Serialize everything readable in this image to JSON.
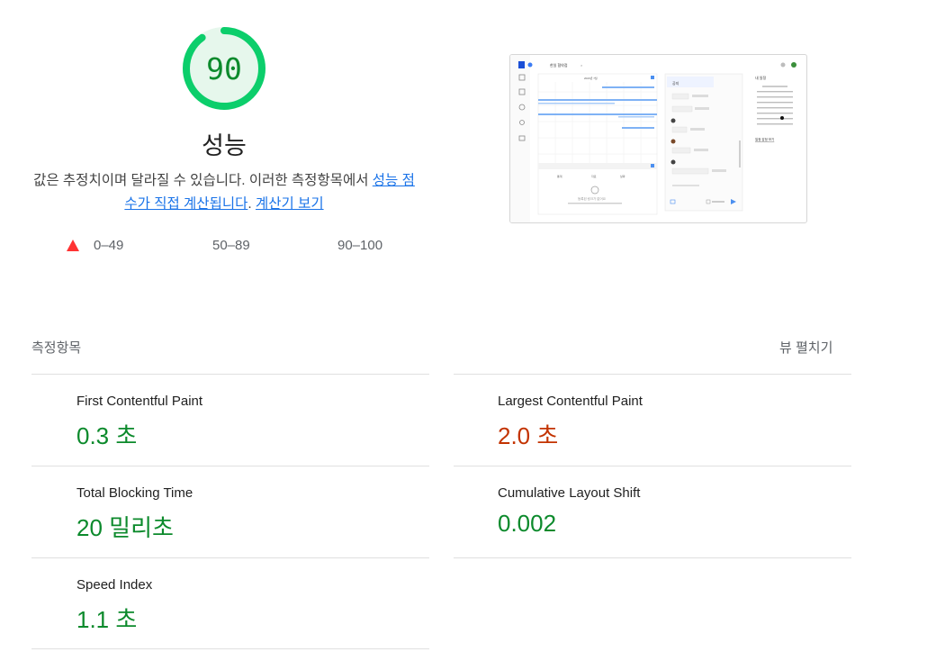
{
  "score": {
    "value": "90",
    "title": "성능",
    "fraction": 0.9,
    "color": "#0c8a2c"
  },
  "description": {
    "text_before": "값은 추정치이며 달라질 수 있습니다. 이러한 측정항목에서 ",
    "link1": "성능 점수가 직접 계산됩니다",
    "text_between": ". ",
    "link2": "계산기 보기"
  },
  "legend": [
    {
      "label": "0–49",
      "color": "#ff3333",
      "shape": "triangle"
    },
    {
      "label": "50–89",
      "color": "#ffaa33",
      "shape": "square"
    },
    {
      "label": "90–100",
      "color": "#0cce6b",
      "shape": "circle"
    }
  ],
  "thumbnail": {
    "page_title": "한일 협약접",
    "month_label": "2023년 7월",
    "card_title": "공지",
    "side_title": "내 일정",
    "side_link": "일정 감정 보기",
    "empty_label": "등록된 링크가 없어요"
  },
  "metrics_section": {
    "title": "측정항목",
    "expand_label": "뷰 펼치기"
  },
  "metrics": [
    {
      "label": "First Contentful Paint",
      "value": "0.3 초",
      "status": "good"
    },
    {
      "label": "Largest Contentful Paint",
      "value": "2.0 초",
      "status": "average"
    },
    {
      "label": "Total Blocking Time",
      "value": "20 밀리초",
      "status": "good"
    },
    {
      "label": "Cumulative Layout Shift",
      "value": "0.002",
      "status": "good"
    },
    {
      "label": "Speed Index",
      "value": "1.1 초",
      "status": "good"
    }
  ]
}
